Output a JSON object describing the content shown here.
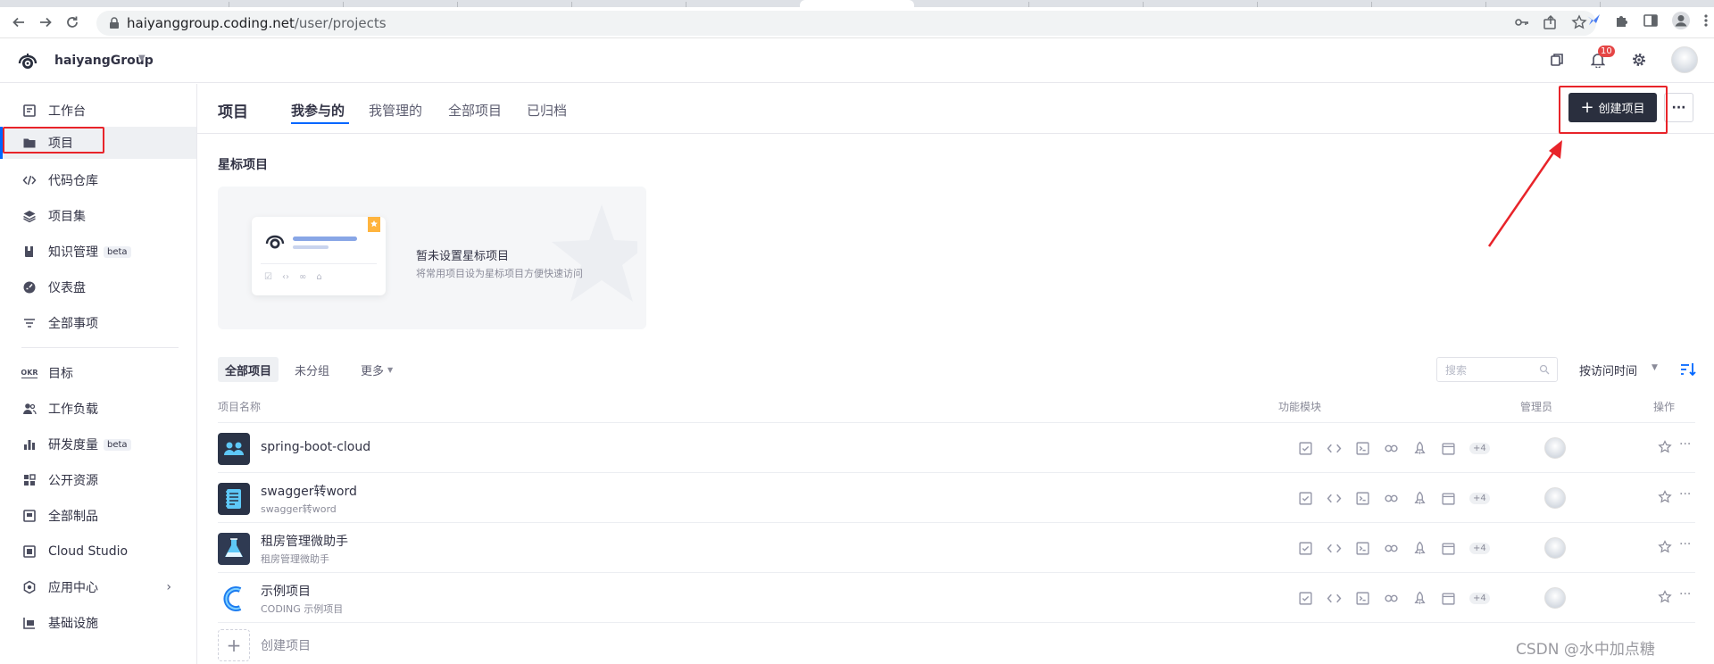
{
  "browser": {
    "url_domain": "haiyanggroup.coding.net",
    "url_path": "/user/projects"
  },
  "header": {
    "team_name": "haiyangGroup",
    "notification_count": "10"
  },
  "sidebar": {
    "items": [
      {
        "label": "工作台",
        "icon": "workbench-icon"
      },
      {
        "label": "项目",
        "icon": "folder-icon",
        "active": true
      },
      {
        "label": "代码仓库",
        "icon": "code-icon"
      },
      {
        "label": "项目集",
        "icon": "layers-icon"
      },
      {
        "label": "知识管理",
        "icon": "book-icon",
        "badge": "beta"
      },
      {
        "label": "仪表盘",
        "icon": "dashboard-icon"
      },
      {
        "label": "全部事项",
        "icon": "filter-list-icon"
      },
      {
        "label": "目标",
        "icon": "okr-icon",
        "icon_text": "OKR"
      },
      {
        "label": "工作负载",
        "icon": "users-icon"
      },
      {
        "label": "研发度量",
        "icon": "bar-chart-icon",
        "badge": "beta"
      },
      {
        "label": "公开资源",
        "icon": "grid-icon"
      },
      {
        "label": "全部制品",
        "icon": "package-icon"
      },
      {
        "label": "Cloud Studio",
        "icon": "cloud-studio-icon"
      },
      {
        "label": "应用中心",
        "icon": "hexagon-icon",
        "has_submenu": true
      },
      {
        "label": "基础设施",
        "icon": "infra-icon"
      }
    ]
  },
  "main": {
    "title": "项目",
    "tabs": [
      "我参与的",
      "我管理的",
      "全部项目",
      "已归档"
    ],
    "active_tab": "我参与的",
    "create_button": "创建项目",
    "starred": {
      "title": "星标项目",
      "empty_title": "暂未设置星标项目",
      "empty_sub": "将常用项目设为星标项目方便快速访问"
    },
    "filters": [
      "全部项目",
      "未分组",
      "更多"
    ],
    "search_placeholder": "搜索",
    "sort_label": "按访问时间",
    "columns": {
      "name": "项目名称",
      "modules": "功能模块",
      "admin": "管理员",
      "actions": "操作"
    },
    "projects": [
      {
        "name": "spring-boot-cloud",
        "sub": "",
        "icon_bg": "#2b3447"
      },
      {
        "name": "swagger转word",
        "sub": "swagger转word",
        "icon_bg": "#2a3347"
      },
      {
        "name": "租房管理微助手",
        "sub": "租房管理微助手",
        "icon_bg": "#2f3a52"
      },
      {
        "name": "示例项目",
        "sub": "CODING 示例项目",
        "icon_bg": "#ffffff"
      }
    ],
    "modules_more": "+4",
    "create_row_label": "创建项目"
  },
  "watermark": "CSDN @水中加点糖",
  "colors": {
    "accent": "#0066ff",
    "create_button_bg": "#2a2f3e",
    "annotation_red": "#e8242a"
  }
}
